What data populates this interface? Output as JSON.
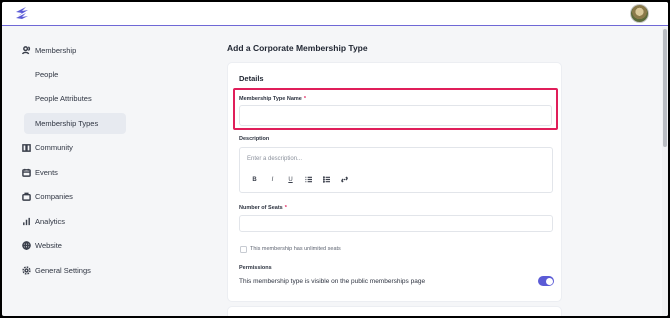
{
  "app": {
    "logo": "lightning-bolt-logo",
    "avatar": "user-avatar"
  },
  "sidebar": {
    "items": [
      {
        "label": "Membership",
        "icon": "users-icon"
      },
      {
        "label": "People"
      },
      {
        "label": "People Attributes"
      },
      {
        "label": "Membership Types",
        "active": true
      },
      {
        "label": "Community",
        "icon": "book-icon"
      },
      {
        "label": "Events",
        "icon": "calendar-icon"
      },
      {
        "label": "Companies",
        "icon": "briefcase-icon"
      },
      {
        "label": "Analytics",
        "icon": "bar-chart-icon"
      },
      {
        "label": "Website",
        "icon": "globe-icon"
      },
      {
        "label": "General Settings",
        "icon": "gear-icon"
      }
    ]
  },
  "main": {
    "title": "Add a Corporate Membership Type",
    "details": {
      "section_title": "Details",
      "membership_type_name": {
        "label": "Membership Type Name",
        "required": "*",
        "value": "",
        "placeholder": ""
      },
      "description": {
        "label": "Description",
        "placeholder": "Enter a description...",
        "toolbar": [
          "B",
          "I",
          "U",
          "ordered-list",
          "bullet-list",
          "link"
        ]
      },
      "number_of_seats": {
        "label": "Number of Seats",
        "required": "*",
        "value": ""
      },
      "unlimited_seats": {
        "label": "This membership has unlimited seats",
        "checked": false
      },
      "permissions": {
        "label": "Permissions",
        "text": "This membership type is visible on the public memberships page",
        "enabled": true
      }
    }
  },
  "colors": {
    "accent": "#5b5bd6",
    "highlight": "#e01e5a"
  }
}
